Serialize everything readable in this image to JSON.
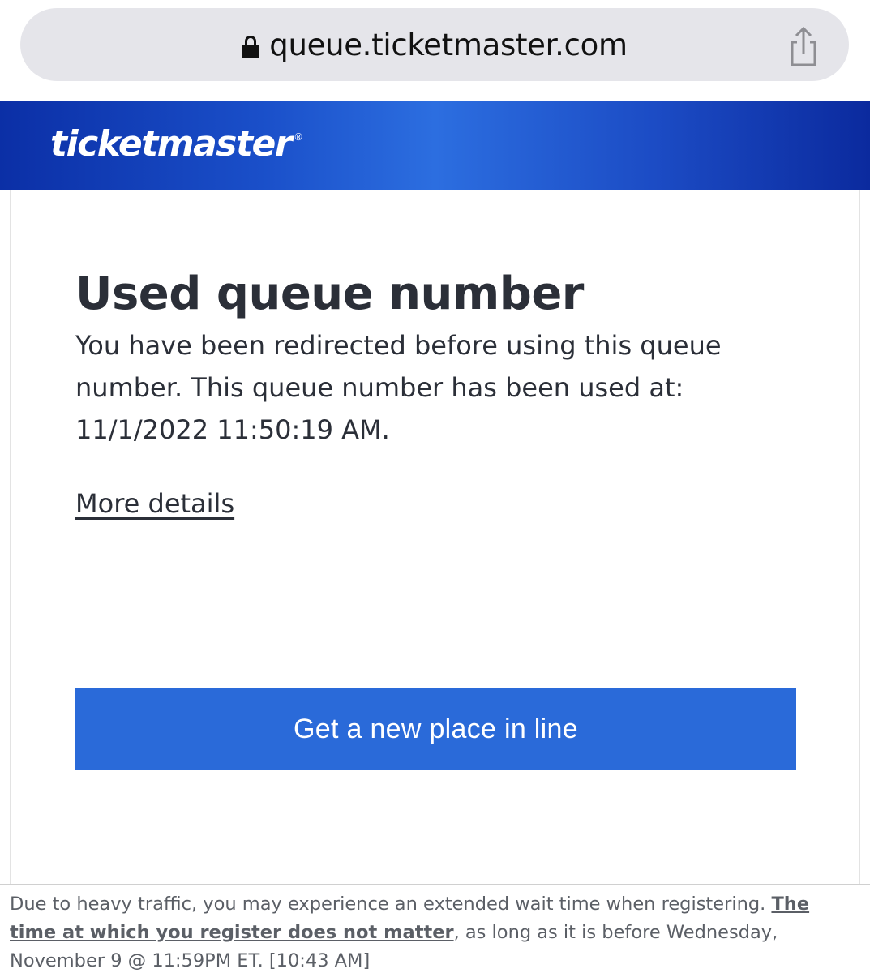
{
  "browser": {
    "url": "queue.ticketmaster.com",
    "lock_icon": "lock-icon",
    "share_icon": "share-icon"
  },
  "header": {
    "logo_text": "ticketmaster",
    "logo_mark": "®",
    "colors": {
      "gradient_dark": "#0b2fa6",
      "gradient_light": "#2c6ee0"
    }
  },
  "main": {
    "title": "Used queue number",
    "description": "You have been redirected before using this queue number. This queue number has been used at: 11/1/2022 11:50:19 AM.",
    "more_details_label": "More details",
    "button_label": "Get a new place in line",
    "button_color": "#2a6ad9"
  },
  "footer": {
    "text_before": "Due to heavy traffic, you may experience an extended wait time when registering. ",
    "link_text": "The time at which you register does not matter",
    "text_after": ", as long as it is before Wednesday, November 9 @ 11:59PM ET. [10:43 AM]"
  }
}
